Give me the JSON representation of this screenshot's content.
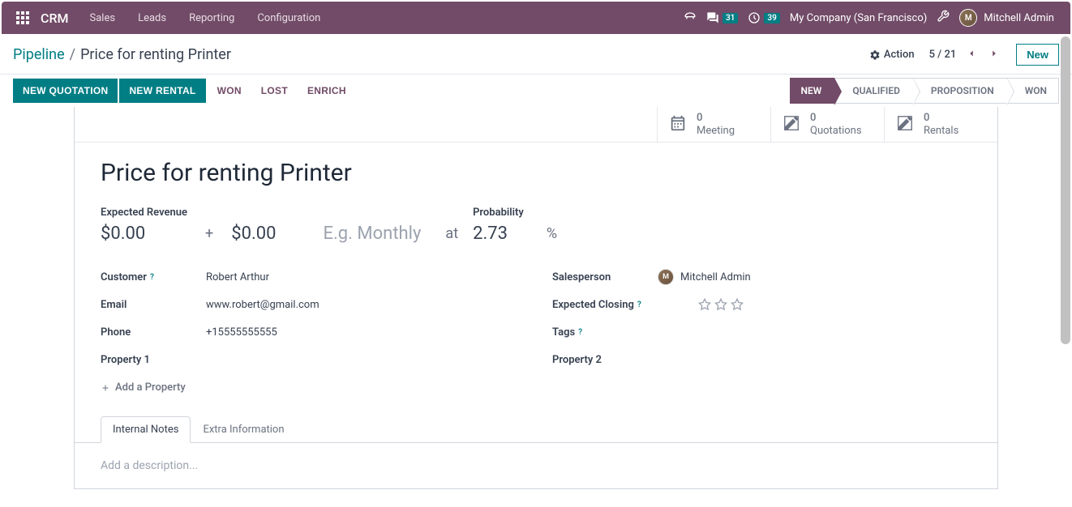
{
  "topnav": {
    "brand": "CRM",
    "menus": [
      "Sales",
      "Leads",
      "Reporting",
      "Configuration"
    ],
    "messages_count": "31",
    "activities_count": "39",
    "company": "My Company (San Francisco)",
    "user_name": "Mitchell Admin",
    "user_initials": "M"
  },
  "breadcrumb": {
    "parent": "Pipeline",
    "current": "Price for renting Printer",
    "action_label": "Action",
    "pager": "5 / 21",
    "new_label": "New"
  },
  "actionbar": {
    "buttons": [
      "NEW QUOTATION",
      "NEW RENTAL"
    ],
    "links": [
      "WON",
      "LOST",
      "ENRICH"
    ],
    "stages": [
      {
        "label": "NEW",
        "active": true
      },
      {
        "label": "QUALIFIED",
        "active": false
      },
      {
        "label": "PROPOSITION",
        "active": false
      },
      {
        "label": "WON",
        "active": false
      }
    ]
  },
  "stats": [
    {
      "icon": "calendar",
      "count": "0",
      "label": "Meeting"
    },
    {
      "icon": "pencil-square",
      "count": "0",
      "label": "Quotations"
    },
    {
      "icon": "pencil-square",
      "count": "0",
      "label": "Rentals"
    }
  ],
  "record": {
    "title": "Price for renting Printer",
    "expected_revenue_label": "Expected Revenue",
    "expected_revenue": "$0.00",
    "recurring_revenue": "$0.00",
    "recurring_placeholder": "E.g. Monthly",
    "at_label": "at",
    "probability_label": "Probability",
    "probability": "2.73",
    "percent": "%",
    "left_fields": [
      {
        "label": "Customer",
        "help": true,
        "value": "Robert Arthur"
      },
      {
        "label": "Email",
        "help": false,
        "value": "www.robert@gmail.com"
      },
      {
        "label": "Phone",
        "help": false,
        "value": "+15555555555"
      },
      {
        "label": "Property 1",
        "help": false,
        "value": ""
      }
    ],
    "right_fields": [
      {
        "label": "Salesperson",
        "help": false,
        "value": "Mitchell Admin",
        "avatar": true
      },
      {
        "label": "Expected Closing",
        "help": true,
        "value": "",
        "priority": true
      },
      {
        "label": "Tags",
        "help": true,
        "value": ""
      },
      {
        "label": "Property 2",
        "help": false,
        "value": ""
      }
    ],
    "add_property_label": "Add a Property"
  },
  "tabs": {
    "items": [
      "Internal Notes",
      "Extra Information"
    ],
    "active": 0,
    "description_placeholder": "Add a description..."
  }
}
